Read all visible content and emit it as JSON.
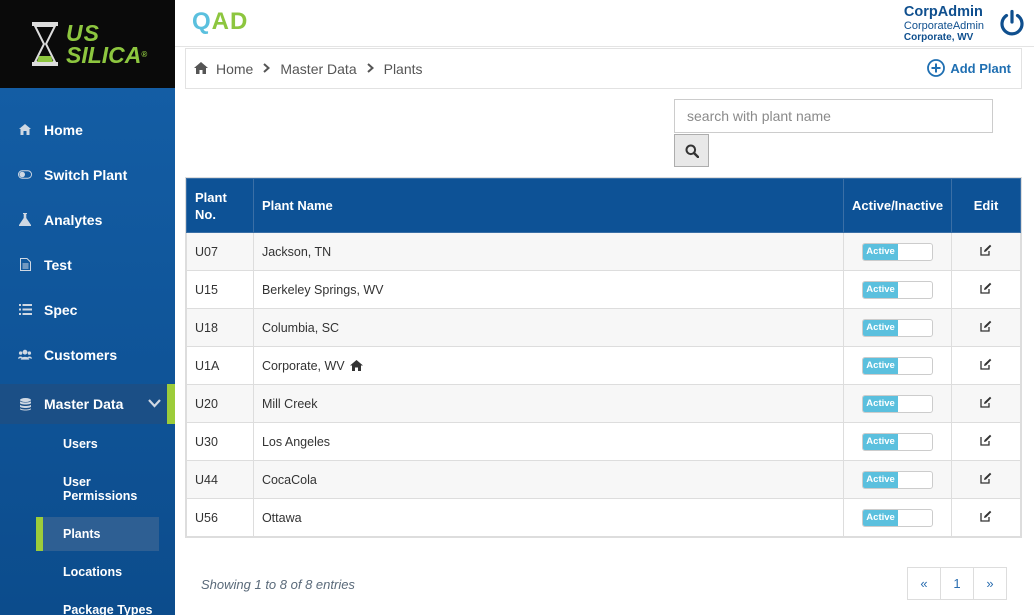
{
  "brand": {
    "logo_line1": "US",
    "logo_line2": "SILICA",
    "logo_reg": "®"
  },
  "app": {
    "title_q": "Q",
    "title_a": "A",
    "title_d": "D"
  },
  "user": {
    "name": "CorpAdmin",
    "role": "CorporateAdmin",
    "location": "Corporate, WV"
  },
  "sidebar": {
    "items": [
      {
        "label": "Home"
      },
      {
        "label": "Switch Plant"
      },
      {
        "label": "Analytes"
      },
      {
        "label": "Test"
      },
      {
        "label": "Spec"
      },
      {
        "label": "Customers"
      },
      {
        "label": "Master Data"
      }
    ],
    "sub_items": [
      {
        "label": "Users"
      },
      {
        "label": "User Permissions"
      },
      {
        "label": "Plants"
      },
      {
        "label": "Locations"
      },
      {
        "label": "Package Types"
      }
    ]
  },
  "breadcrumb": {
    "home": "Home",
    "section": "Master Data",
    "page": "Plants"
  },
  "toolbar": {
    "add_label": "Add Plant"
  },
  "search": {
    "placeholder": "search with plant name",
    "value": ""
  },
  "table": {
    "headers": {
      "no": "Plant No.",
      "name": "Plant Name",
      "status": "Active/Inactive",
      "edit": "Edit"
    },
    "rows": [
      {
        "no": "U07",
        "name": "Jackson, TN",
        "status": "Active"
      },
      {
        "no": "U15",
        "name": "Berkeley Springs, WV",
        "status": "Active"
      },
      {
        "no": "U18",
        "name": "Columbia, SC",
        "status": "Active"
      },
      {
        "no": "U1A",
        "name": "Corporate, WV",
        "status": "Active"
      },
      {
        "no": "U20",
        "name": "Mill Creek",
        "status": "Active"
      },
      {
        "no": "U30",
        "name": "Los Angeles",
        "status": "Active"
      },
      {
        "no": "U44",
        "name": "CocaCola",
        "status": "Active"
      },
      {
        "no": "U56",
        "name": "Ottawa",
        "status": "Active"
      }
    ]
  },
  "footer": {
    "showing": "Showing 1 to 8 of 8 entries"
  },
  "pagination": {
    "prev": "«",
    "page": "1",
    "next": "»"
  },
  "colors": {
    "accent_blue": "#0d5296",
    "brand_green": "#8dc63f",
    "toggle_on": "#5bc0de"
  }
}
